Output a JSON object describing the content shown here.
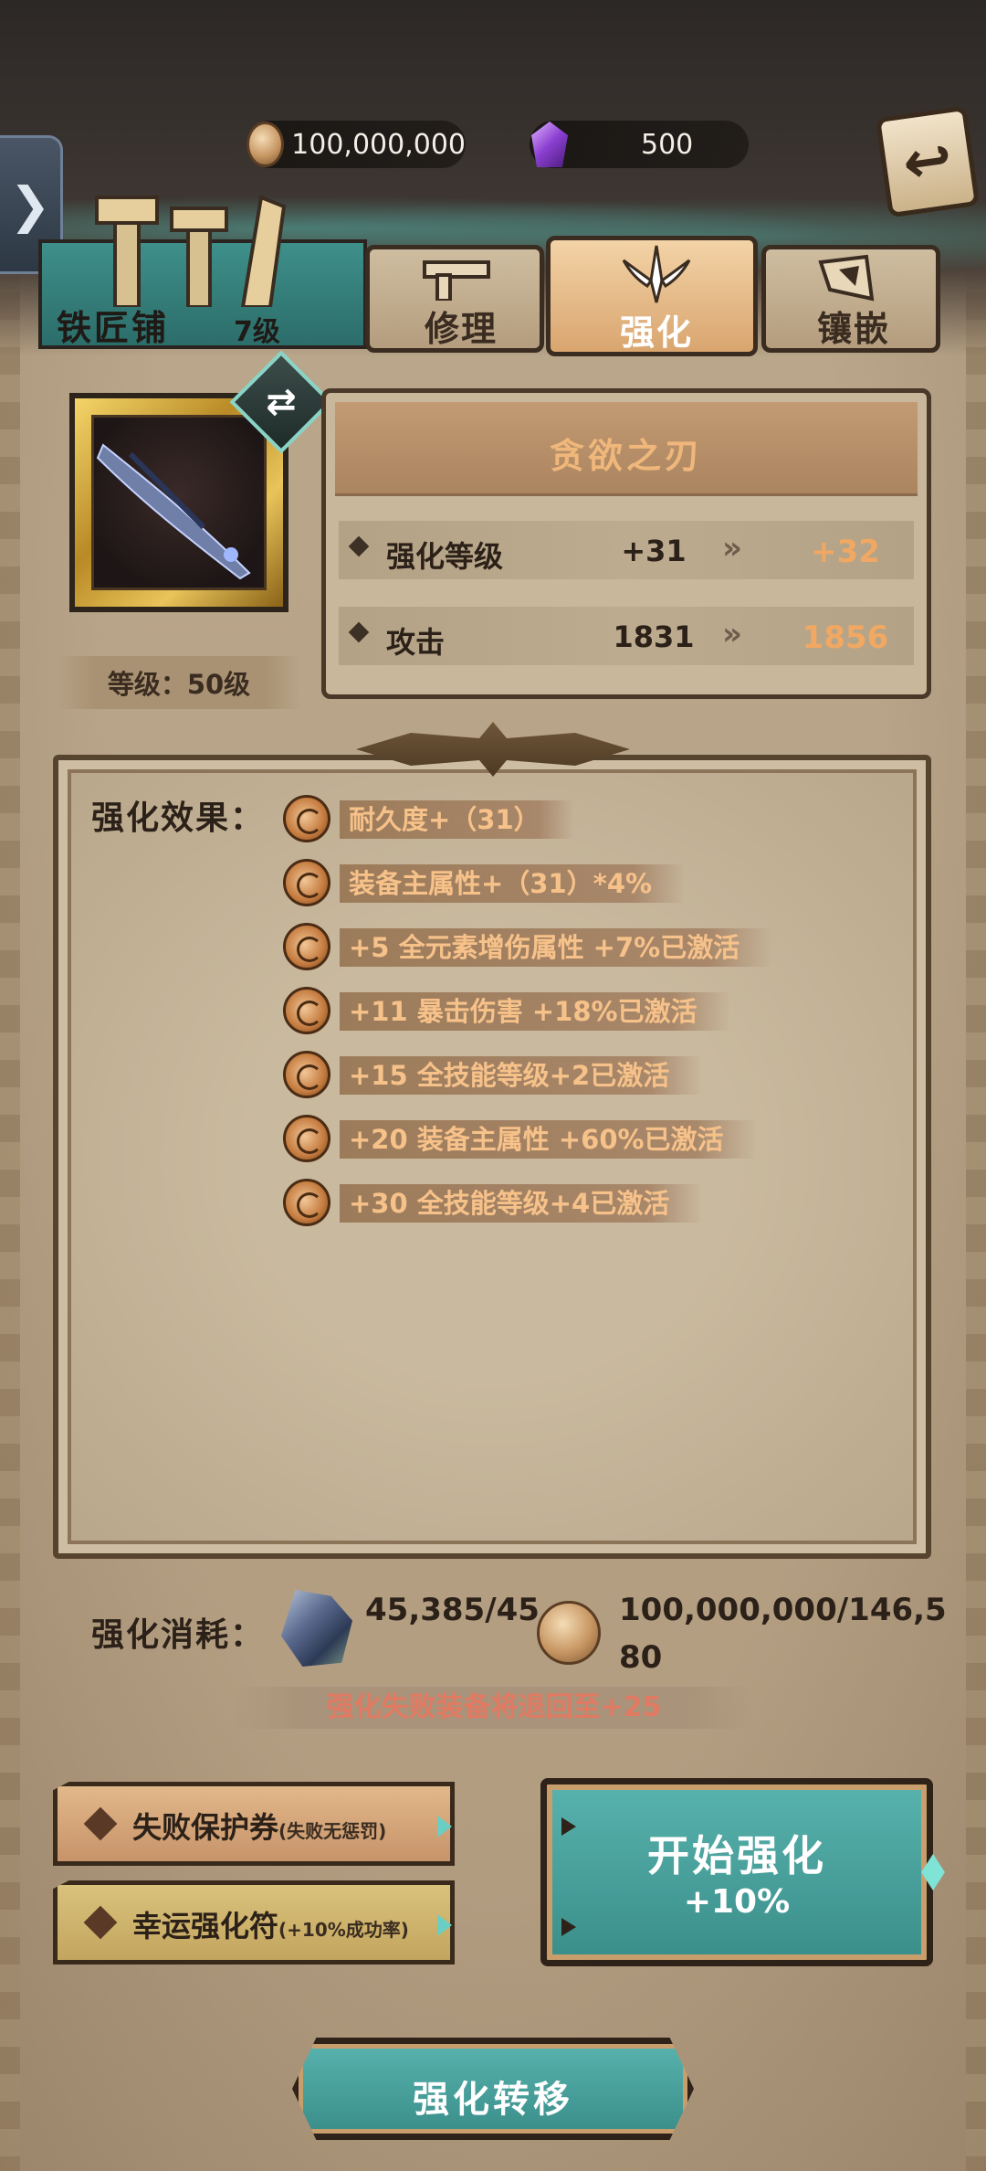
{
  "currency": {
    "gold": "100,000,000",
    "gems": "500"
  },
  "shop": {
    "name": "铁匠铺",
    "level": "7级"
  },
  "tabs": [
    {
      "label": "修理",
      "icon": "hammer-icon"
    },
    {
      "label": "强化",
      "icon": "sword-emblem-icon"
    },
    {
      "label": "镶嵌",
      "icon": "gem-socket-icon"
    }
  ],
  "active_tab": "强化",
  "item": {
    "name": "贪欲之刃",
    "level_text": "等级：50级",
    "stats": [
      {
        "label": "强化等级",
        "current": "+31",
        "next": "+32"
      },
      {
        "label": "攻击",
        "current": "1831",
        "next": "1856"
      }
    ]
  },
  "effects": {
    "label": "强化效果：",
    "items": [
      "耐久度+（31）",
      "装备主属性+（31）*4%",
      "+5  全元素增伤属性 +7%已激活",
      "+11  暴击伤害 +18%已激活",
      "+15  全技能等级+2已激活",
      "+20  装备主属性 +60%已激活",
      "+30  全技能等级+4已激活"
    ]
  },
  "cost": {
    "label": "强化消耗：",
    "ore": "45,385/45",
    "gold": "100,000,000/146,580",
    "warning": "强化失败装备将退回至+25"
  },
  "buttons": {
    "protect": {
      "label": "失败保护券",
      "sub": "(失败无惩罚)"
    },
    "lucky": {
      "label": "幸运强化符",
      "sub": "(+10%成功率)"
    },
    "start": {
      "label": "开始强化",
      "bonus": "+10%"
    },
    "transfer": "强化转移",
    "side_toggle": "❯",
    "back": "↩"
  },
  "colors": {
    "accent_orange": "#f0a862",
    "teal_button": "#4aa09b",
    "warning_red": "#e07a62"
  }
}
